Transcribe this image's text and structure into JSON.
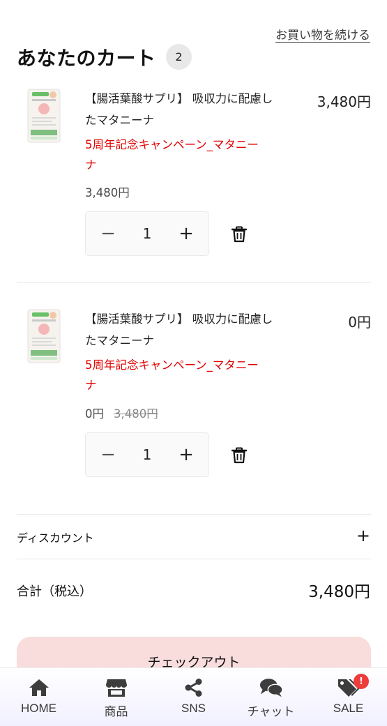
{
  "header": {
    "continue_shopping": "お買い物を続ける",
    "title": "あなたのカート",
    "item_count": "2"
  },
  "cart_items": [
    {
      "name": "【腸活葉酸サプリ】 吸収力に配慮したマタニーナ",
      "campaign": "5周年記念キャンペーン_マタニーナ",
      "unit_price": "3,480円",
      "original_price": "",
      "quantity": "1",
      "line_total": "3,480円"
    },
    {
      "name": "【腸活葉酸サプリ】 吸収力に配慮したマタニーナ",
      "campaign": "5周年記念キャンペーン_マタニーナ",
      "unit_price": "0円",
      "original_price": "3,480円",
      "quantity": "1",
      "line_total": "0円"
    }
  ],
  "quantity_controls": {
    "minus": "−",
    "plus": "+"
  },
  "discount": {
    "label": "ディスカウント",
    "toggle": "+"
  },
  "summary": {
    "total_label": "合計（税込）",
    "total_value": "3,480円"
  },
  "checkout": {
    "label": "チェックアウト"
  },
  "bottom_nav": {
    "items": [
      {
        "label": "HOME",
        "icon": "home-icon"
      },
      {
        "label": "商品",
        "icon": "store-icon"
      },
      {
        "label": "SNS",
        "icon": "share-icon"
      },
      {
        "label": "チャット",
        "icon": "chat-icon"
      },
      {
        "label": "SALE",
        "icon": "tags-icon"
      }
    ],
    "sale_badge": "!"
  },
  "colors": {
    "campaign_text": "#e00000",
    "checkout_bg": "#f9dcdc",
    "badge_red": "#ee3b3b"
  }
}
